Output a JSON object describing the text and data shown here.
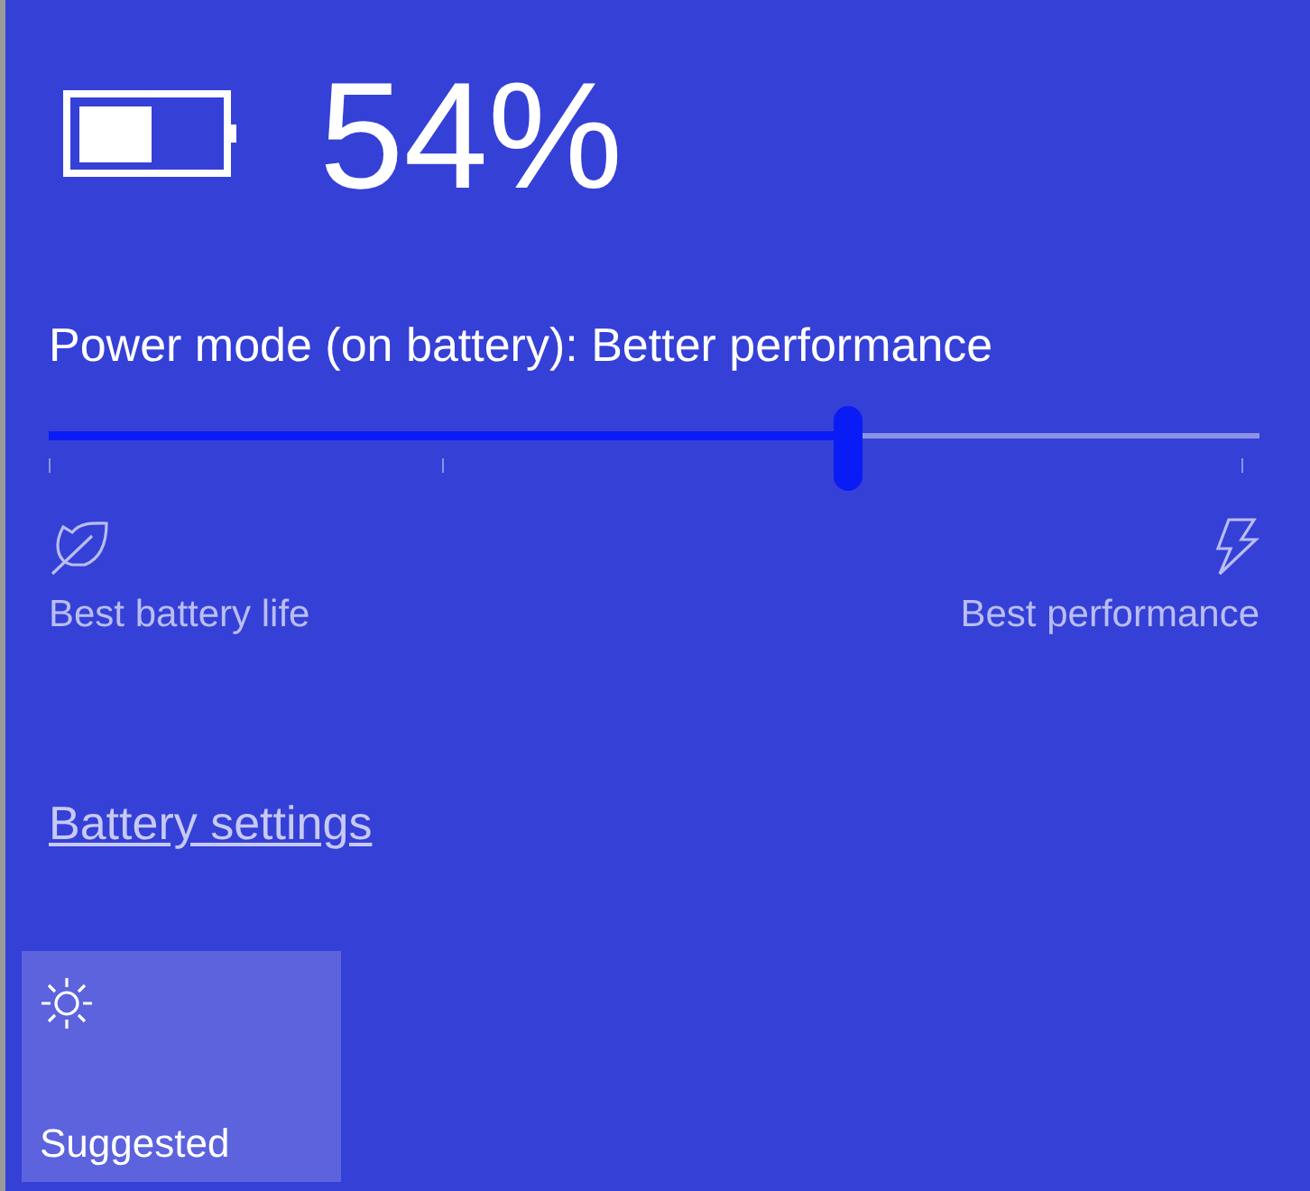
{
  "battery": {
    "percent": "54%"
  },
  "power_mode": {
    "label": "Power mode (on battery): Better performance",
    "level": 0.66,
    "min_label": "Best battery life",
    "max_label": "Best performance"
  },
  "link": "Battery settings",
  "tiles": [
    {
      "label": "Suggested",
      "kind": "brightness"
    }
  ]
}
